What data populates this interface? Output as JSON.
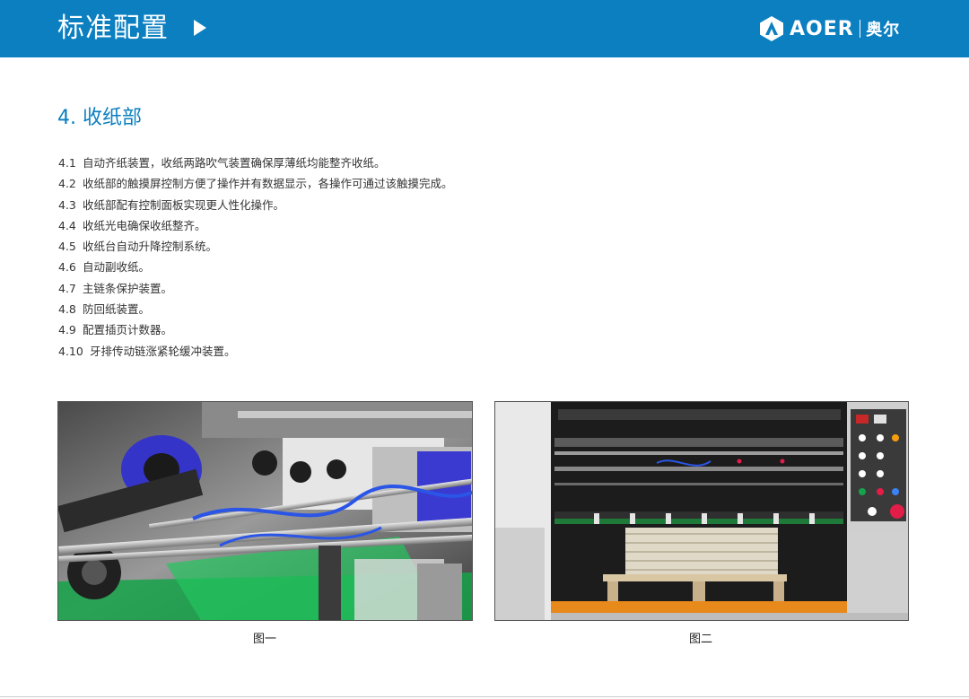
{
  "header": {
    "title": "标准配置",
    "logo_en": "AOER",
    "logo_cn": "奥尔",
    "color": "#0b7fc0"
  },
  "section": {
    "title": "4. 收纸部"
  },
  "items": [
    {
      "num": "4.1",
      "text": "自动齐纸装置，收纸两路吹气装置确保厚薄纸均能整齐收纸。"
    },
    {
      "num": "4.2",
      "text": "收纸部的触摸屏控制方便了操作并有数据显示，各操作可通过该触摸完成。"
    },
    {
      "num": "4.3",
      "text": "收纸部配有控制面板实现更人性化操作。"
    },
    {
      "num": "4.4",
      "text": "收纸光电确保收纸整齐。"
    },
    {
      "num": "4.5",
      "text": "收纸台自动升降控制系统。"
    },
    {
      "num": "4.6",
      "text": "自动副收纸。"
    },
    {
      "num": "4.7",
      "text": "主链条保护装置。"
    },
    {
      "num": "4.8",
      "text": "防回纸装置。"
    },
    {
      "num": "4.9",
      "text": "配置插页计数器。"
    },
    {
      "num": "4.10",
      "text": "牙排传动链涨紧轮缓冲装置。"
    }
  ],
  "figures": [
    {
      "caption": "图一"
    },
    {
      "caption": "图二"
    }
  ]
}
